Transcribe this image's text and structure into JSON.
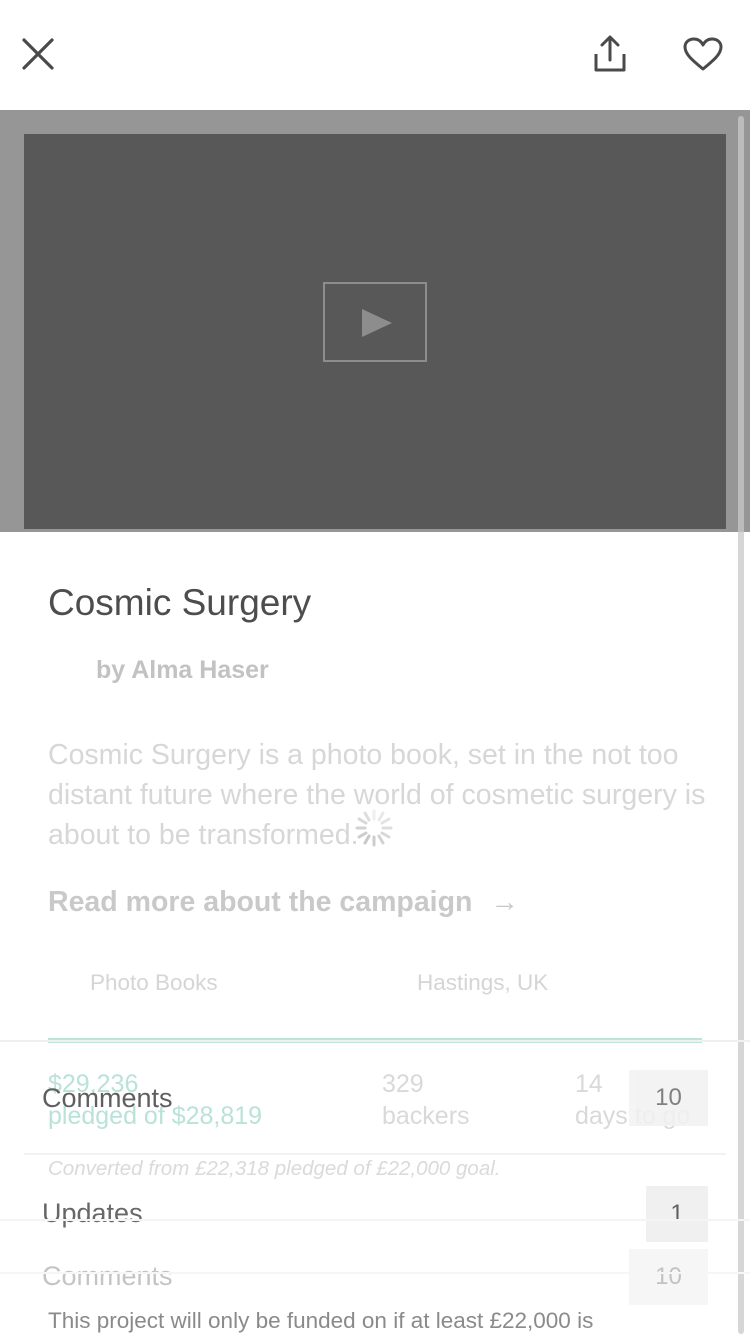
{
  "header": {
    "close_icon": "close-icon",
    "share_icon": "share-icon",
    "heart_icon": "heart-icon"
  },
  "video": {
    "play_icon": "play-icon"
  },
  "project": {
    "title": "Cosmic Surgery",
    "byline": "by Alma Haser",
    "blurb": "Cosmic Surgery is a photo book, set in the not too distant future where the world of cosmetic surgery is about to be transformed.",
    "read_more": "Read more about the campaign",
    "read_more_arrow": "→",
    "category": "Photo Books",
    "location": "Hastings, UK"
  },
  "stats": {
    "pledged": "$29,236",
    "pledged_goal": "pledged of $28,819",
    "backers_count": "329",
    "backers_label": "backers",
    "days_count": "14",
    "days_label": "days to go",
    "progress_percent": 100,
    "converted_note": "Converted from £22,318 pledged of £22,000 goal."
  },
  "rows": {
    "comments_overlay_label": "Comments",
    "comments_overlay_count": "10",
    "updates_label": "Updates",
    "updates_count": "1",
    "comments_label": "Comments",
    "comments_count": "10"
  },
  "footer": {
    "funding_note": "This project will only be funded on if at least £22,000 is"
  },
  "colors": {
    "accent_green": "#bde3da",
    "video_bg": "#585858"
  }
}
